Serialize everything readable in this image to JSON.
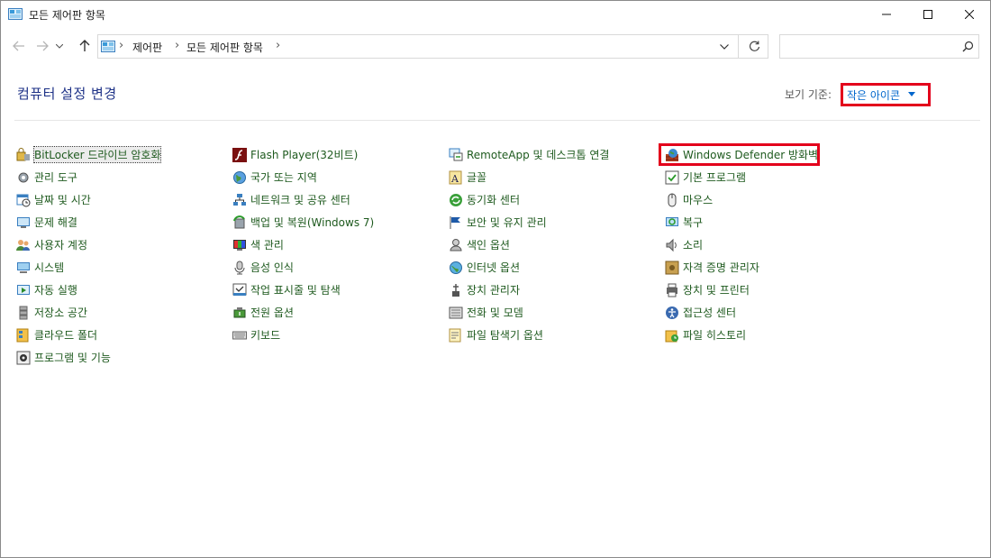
{
  "window": {
    "title": "모든 제어판 항목"
  },
  "breadcrumb": {
    "items": [
      "제어판",
      "모든 제어판 항목"
    ]
  },
  "search": {
    "placeholder": ""
  },
  "header": {
    "title": "컴퓨터 설정 변경",
    "viewby_label": "보기 기준:",
    "viewby_value": "작은 아이콘"
  },
  "colors": {
    "link_green": "#1e5a1e",
    "title_blue": "#1e3287",
    "highlight_red": "#e3001b",
    "viewby_blue": "#0066cc"
  },
  "columns": [
    [
      {
        "label": "BitLocker 드라이브 암호화",
        "icon": "bitlocker-icon"
      },
      {
        "label": "관리 도구",
        "icon": "admin-tools-icon"
      },
      {
        "label": "날짜 및 시간",
        "icon": "date-time-icon"
      },
      {
        "label": "문제 해결",
        "icon": "troubleshoot-icon"
      },
      {
        "label": "사용자 계정",
        "icon": "user-accounts-icon"
      },
      {
        "label": "시스템",
        "icon": "system-icon"
      },
      {
        "label": "자동 실행",
        "icon": "autoplay-icon"
      },
      {
        "label": "저장소 공간",
        "icon": "storage-spaces-icon"
      },
      {
        "label": "클라우드 폴더",
        "icon": "cloud-folder-icon"
      },
      {
        "label": "프로그램 및 기능",
        "icon": "programs-features-icon"
      }
    ],
    [
      {
        "label": "Flash Player(32비트)",
        "icon": "flash-player-icon"
      },
      {
        "label": "국가 또는 지역",
        "icon": "region-icon"
      },
      {
        "label": "네트워크 및 공유 센터",
        "icon": "network-sharing-icon"
      },
      {
        "label": "백업 및 복원(Windows 7)",
        "icon": "backup-restore-icon"
      },
      {
        "label": "색 관리",
        "icon": "color-management-icon"
      },
      {
        "label": "음성 인식",
        "icon": "speech-recognition-icon"
      },
      {
        "label": "작업 표시줄 및 탐색",
        "icon": "taskbar-icon"
      },
      {
        "label": "전원 옵션",
        "icon": "power-options-icon"
      },
      {
        "label": "키보드",
        "icon": "keyboard-icon"
      }
    ],
    [
      {
        "label": "RemoteApp 및 데스크톱 연결",
        "icon": "remoteapp-icon"
      },
      {
        "label": "글꼴",
        "icon": "fonts-icon"
      },
      {
        "label": "동기화 센터",
        "icon": "sync-center-icon"
      },
      {
        "label": "보안 및 유지 관리",
        "icon": "security-maintenance-icon"
      },
      {
        "label": "색인 옵션",
        "icon": "indexing-options-icon"
      },
      {
        "label": "인터넷 옵션",
        "icon": "internet-options-icon"
      },
      {
        "label": "장치 관리자",
        "icon": "device-manager-icon"
      },
      {
        "label": "전화 및 모뎀",
        "icon": "phone-modem-icon"
      },
      {
        "label": "파일 탐색기 옵션",
        "icon": "file-explorer-options-icon"
      }
    ],
    [
      {
        "label": "Windows Defender 방화벽",
        "icon": "firewall-icon"
      },
      {
        "label": "기본 프로그램",
        "icon": "default-programs-icon"
      },
      {
        "label": "마우스",
        "icon": "mouse-icon"
      },
      {
        "label": "복구",
        "icon": "recovery-icon"
      },
      {
        "label": "소리",
        "icon": "sound-icon"
      },
      {
        "label": "자격 증명 관리자",
        "icon": "credential-manager-icon"
      },
      {
        "label": "장치 및 프린터",
        "icon": "devices-printers-icon"
      },
      {
        "label": "접근성 센터",
        "icon": "ease-of-access-icon"
      },
      {
        "label": "파일 히스토리",
        "icon": "file-history-icon"
      }
    ]
  ]
}
